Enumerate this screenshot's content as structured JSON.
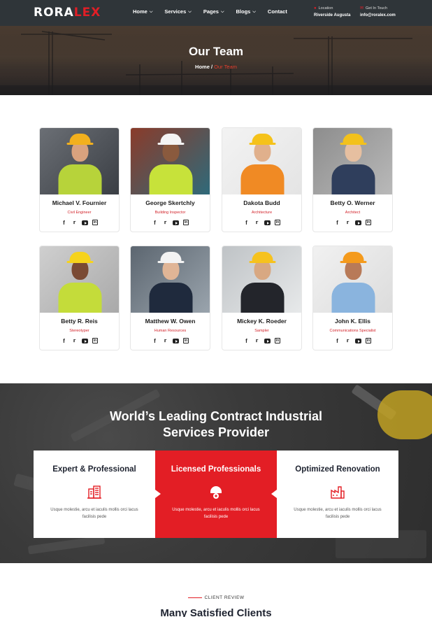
{
  "header": {
    "logo_main": "RORA",
    "logo_accent": "LEX",
    "nav": [
      {
        "label": "Home",
        "dropdown": true
      },
      {
        "label": "Services",
        "dropdown": true
      },
      {
        "label": "Pages",
        "dropdown": true
      },
      {
        "label": "Blogs",
        "dropdown": true
      },
      {
        "label": "Contact",
        "dropdown": false
      }
    ],
    "location_label": "Location",
    "location_value": "Riverside Augusta",
    "contact_label": "Get In Touch",
    "contact_value": "info@roralex.com"
  },
  "banner": {
    "title": "Our Team",
    "breadcrumb_home": "Home",
    "breadcrumb_sep": "/",
    "breadcrumb_current": "Our Team"
  },
  "team": [
    {
      "name": "Michael V. Fournier",
      "role": "Civil Engineer"
    },
    {
      "name": "George Skertchly",
      "role": "Building Inspector"
    },
    {
      "name": "Dakota Budd",
      "role": "Architecture"
    },
    {
      "name": "Betty O. Werner",
      "role": "Architect"
    },
    {
      "name": "Betty R. Reis",
      "role": "Stereotyper"
    },
    {
      "name": "Matthew W. Owen",
      "role": "Human Resources"
    },
    {
      "name": "Mickey K. Roeder",
      "role": "Sampler"
    },
    {
      "name": "John K. Ellis",
      "role": "Communications Specialist"
    }
  ],
  "services": {
    "title_line1": "World’s Leading Contract Industrial",
    "title_line2": "Services Provider",
    "items": [
      {
        "title": "Expert & Professional",
        "desc": "Usque molestie, arcu et iaculis mollis orci lacus facilisis pede",
        "icon": "building-icon"
      },
      {
        "title": "Licensed Professionals",
        "desc": "Usque molestie, arcu et iaculis mollis orci lacus facilisis pede",
        "icon": "hardhat-gear-icon"
      },
      {
        "title": "Optimized Renovation",
        "desc": "Usque molestie, arcu et iaculis mollis orci lacus facilisis pede",
        "icon": "factory-icon"
      }
    ]
  },
  "review": {
    "tag": "CLIENT REVIEW",
    "title": "Many Satisfied Clients"
  },
  "colors": {
    "accent": "#e31e25",
    "header_bg": "#2f3539",
    "dark_text": "#1e2330"
  }
}
